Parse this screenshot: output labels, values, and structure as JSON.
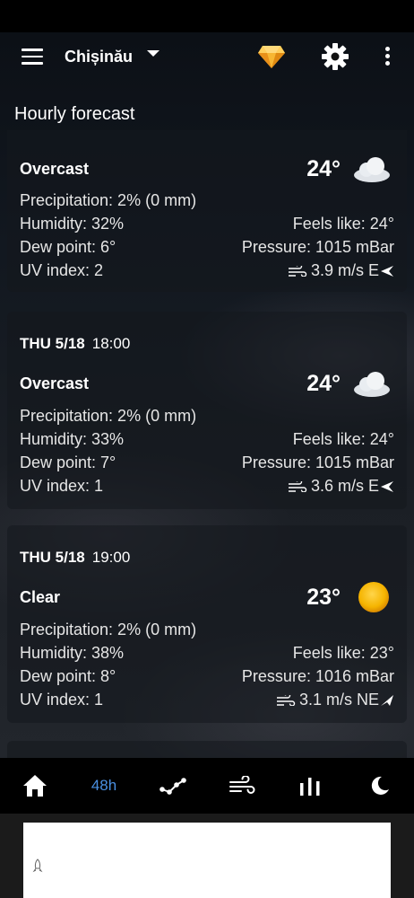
{
  "header": {
    "city": "Chișinău",
    "menu_icon": "hamburger-menu-icon",
    "premium_icon": "diamond-gem-icon",
    "settings_icon": "gear-icon",
    "more_icon": "vertical-dots-icon",
    "section_title": "Hourly forecast"
  },
  "cards": [
    {
      "time_day": "",
      "time_hour": "",
      "condition": "Overcast",
      "temp": "24°",
      "icon": "cloud-icon",
      "precipitation": "Precipitation: 2% (0 mm)",
      "humidity": "Humidity: 32%",
      "feels_like": "Feels like: 24°",
      "dew_point": "Dew point: 6°",
      "pressure": "Pressure: 1015 mBar",
      "uv_index": "UV index: 2",
      "wind": "3.9 m/s E"
    },
    {
      "time_day": "THU 5/18",
      "time_hour": "18:00",
      "condition": "Overcast",
      "temp": "24°",
      "icon": "cloud-icon",
      "precipitation": "Precipitation: 2% (0 mm)",
      "humidity": "Humidity: 33%",
      "feels_like": "Feels like: 24°",
      "dew_point": "Dew point: 7°",
      "pressure": "Pressure: 1015 mBar",
      "uv_index": "UV index: 1",
      "wind": "3.6 m/s E"
    },
    {
      "time_day": "THU 5/18",
      "time_hour": "19:00",
      "condition": "Clear",
      "temp": "23°",
      "icon": "sun-icon",
      "precipitation": "Precipitation: 2% (0 mm)",
      "humidity": "Humidity: 38%",
      "feels_like": "Feels like: 23°",
      "dew_point": "Dew point: 8°",
      "pressure": "Pressure: 1016 mBar",
      "uv_index": "UV index: 1",
      "wind": "3.1 m/s NE"
    }
  ],
  "bottom_nav": {
    "home_icon": "home-icon",
    "label_48h": "48h",
    "graph_icon": "graph-icon",
    "wind_icon": "wind-icon",
    "bars_icon": "bar-chart-icon",
    "moon_icon": "moon-icon",
    "active_color": "#4a90e2"
  }
}
